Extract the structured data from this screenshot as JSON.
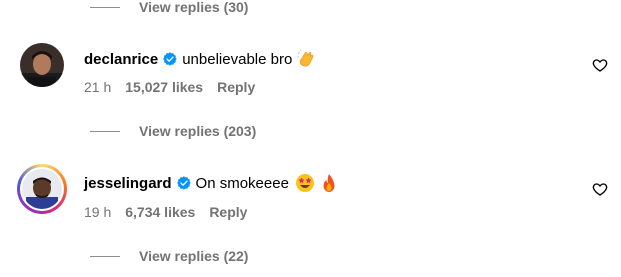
{
  "top_replies": {
    "label": "View replies (30)"
  },
  "comments": [
    {
      "username": "declanrice",
      "text": "unbelievable bro",
      "emoji": "clapping-hands",
      "time": "21 h",
      "likes": "15,027 likes",
      "reply": "Reply",
      "view_replies": "View replies (203)"
    },
    {
      "username": "jesselingard",
      "text": "On smokeeee",
      "emoji": "star-struck-and-fire",
      "time": "19 h",
      "likes": "6,734 likes",
      "reply": "Reply",
      "view_replies": "View replies (22)"
    }
  ],
  "colors": {
    "verified": "#0095f6",
    "secondary_text": "#737373"
  }
}
